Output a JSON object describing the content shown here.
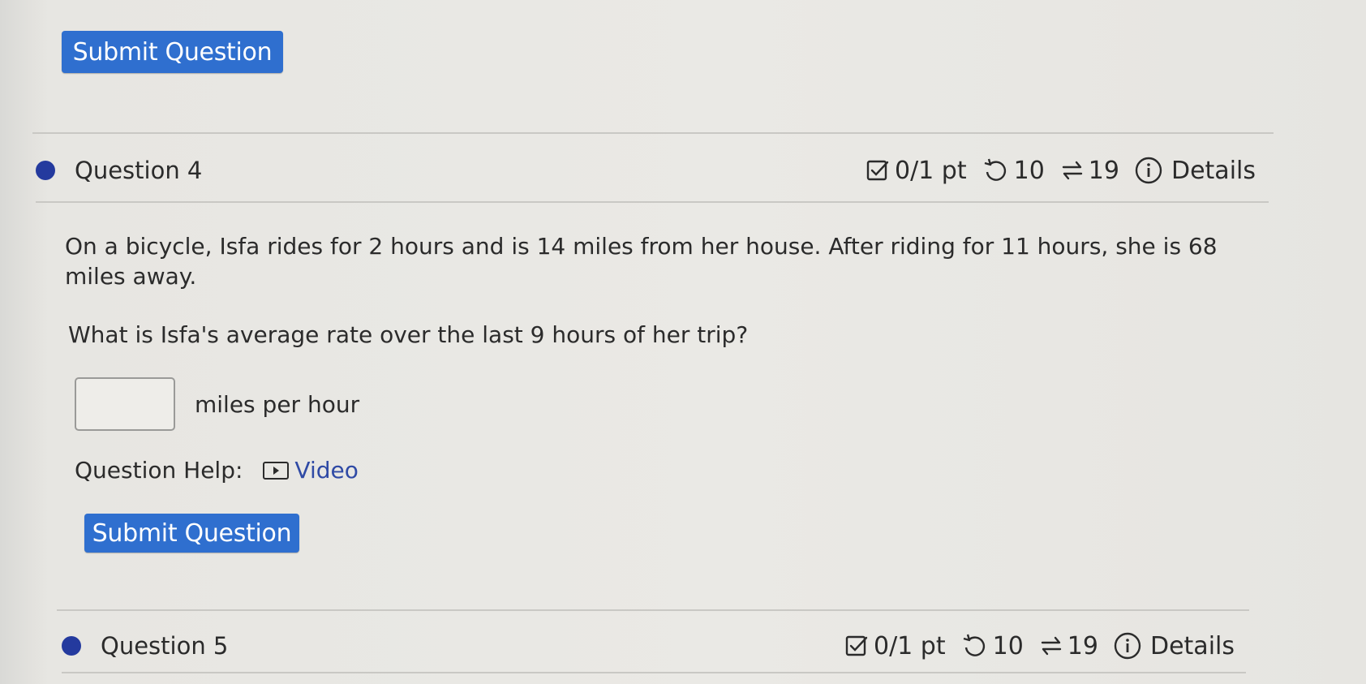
{
  "top_submit_label": "Submit Question",
  "question4": {
    "title": "Question 4",
    "points": "0/1 pt",
    "retries": "10",
    "attempts": "19",
    "details_label": "Details",
    "paragraph1": "On a bicycle, Isfa rides for 2 hours and is 14 miles from her house. After riding for 11 hours, she is 68 miles away.",
    "paragraph2": "What is Isfa's average rate over the last 9 hours of her trip?",
    "answer_value": "",
    "unit_label": "miles per hour",
    "help_label": "Question Help:",
    "video_label": "Video",
    "submit_label": "Submit Question"
  },
  "question5": {
    "title": "Question 5",
    "points": "0/1 pt",
    "retries": "10",
    "attempts": "19",
    "details_label": "Details"
  },
  "colors": {
    "button": "#2f6fcf",
    "bullet": "#243a9e",
    "link": "#2f4aa5"
  },
  "icons": [
    "checkbox-icon",
    "retry-icon",
    "attempts-icon",
    "info-icon",
    "video-icon"
  ]
}
